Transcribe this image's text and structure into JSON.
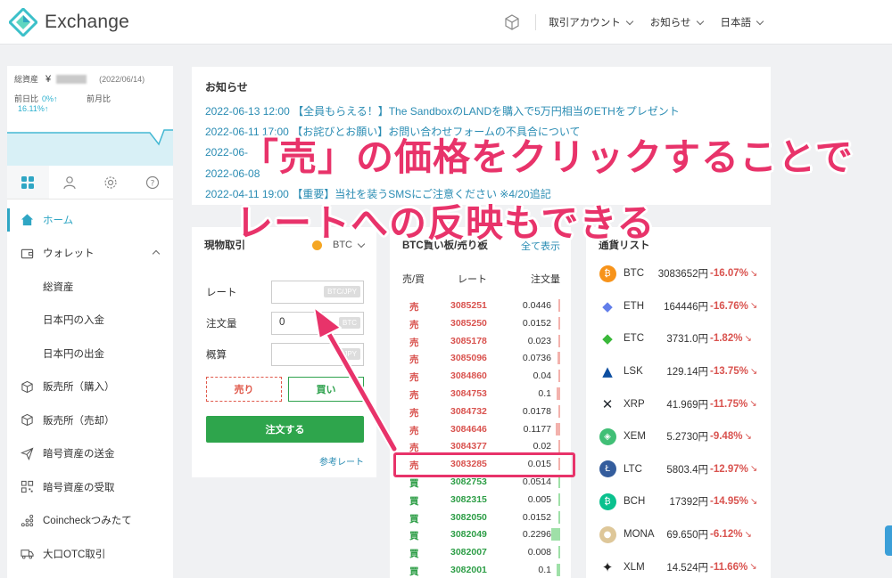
{
  "header": {
    "brand": "Exchange",
    "nav": [
      "取引アカウント",
      "お知らせ",
      "日本語"
    ]
  },
  "sidebar": {
    "assets": {
      "label": "総資産",
      "currency": "¥",
      "date": "(2022/06/14)",
      "day_label": "前日比",
      "day_pct": "0%↑",
      "month_label": "前月比",
      "month_pct": "16.11%↑"
    },
    "tabs": [
      "dashboard-icon",
      "user-icon",
      "gear-icon",
      "help-icon"
    ],
    "menu": [
      {
        "label": "ホーム",
        "icon": "home-icon"
      },
      {
        "label": "ウォレット",
        "icon": "wallet-icon"
      },
      {
        "label": "総資産",
        "icon": ""
      },
      {
        "label": "日本円の入金",
        "icon": ""
      },
      {
        "label": "日本円の出金",
        "icon": ""
      },
      {
        "label": "販売所（購入）",
        "icon": "cube-icon"
      },
      {
        "label": "販売所（売却）",
        "icon": "cube-icon"
      },
      {
        "label": "暗号資産の送金",
        "icon": "send-icon"
      },
      {
        "label": "暗号資産の受取",
        "icon": "qr-icon"
      },
      {
        "label": "Coincheckつみたて",
        "icon": "dots-icon"
      },
      {
        "label": "大口OTC取引",
        "icon": "truck-icon"
      }
    ]
  },
  "news": {
    "title": "お知らせ",
    "items": [
      "2022-06-13 12:00 【全員もらえる！】The SandboxのLANDを購入で5万円相当のETHをプレゼント",
      "2022-06-11 17:00 【お詫びとお願い】お問い合わせフォームの不具合について",
      "2022-06-",
      "2022-06-08",
      "2022-04-11 19:00 【重要】当社を装うSMSにご注意ください ※4/20追記"
    ]
  },
  "trade": {
    "title": "現物取引",
    "coin": "BTC",
    "rate_label": "レート",
    "rate_unit": "BTC/JPY",
    "amount_label": "注文量",
    "amount_value": "0",
    "amount_unit": "BTC",
    "estimate_label": "概算",
    "estimate_unit": "JPY",
    "sell_label": "売り",
    "buy_label": "買い",
    "order_label": "注文する",
    "ref_label": "参考レート"
  },
  "orderbook": {
    "title": "BTC買い板/売り板",
    "show_all": "全て表示",
    "col_side": "売/買",
    "col_rate": "レート",
    "col_qty": "注文量",
    "rows": [
      {
        "side": "売",
        "rate": "3085251",
        "qty": "0.0446",
        "depth": 0.02
      },
      {
        "side": "売",
        "rate": "3085250",
        "qty": "0.0152",
        "depth": 0.01
      },
      {
        "side": "売",
        "rate": "3085178",
        "qty": "0.023",
        "depth": 0.01
      },
      {
        "side": "売",
        "rate": "3085096",
        "qty": "0.0736",
        "depth": 0.03
      },
      {
        "side": "売",
        "rate": "3084860",
        "qty": "0.04",
        "depth": 0.02
      },
      {
        "side": "売",
        "rate": "3084753",
        "qty": "0.1",
        "depth": 0.04
      },
      {
        "side": "売",
        "rate": "3084732",
        "qty": "0.0178",
        "depth": 0.01
      },
      {
        "side": "売",
        "rate": "3084646",
        "qty": "0.1177",
        "depth": 0.05
      },
      {
        "side": "売",
        "rate": "3084377",
        "qty": "0.02",
        "depth": 0.01
      },
      {
        "side": "売",
        "rate": "3083285",
        "qty": "0.015",
        "depth": 0.01
      },
      {
        "side": "買",
        "rate": "3082753",
        "qty": "0.0514",
        "depth": 0.02
      },
      {
        "side": "買",
        "rate": "3082315",
        "qty": "0.005",
        "depth": 0.005
      },
      {
        "side": "買",
        "rate": "3082050",
        "qty": "0.0152",
        "depth": 0.01
      },
      {
        "side": "買",
        "rate": "3082049",
        "qty": "0.2296",
        "depth": 0.1
      },
      {
        "side": "買",
        "rate": "3082007",
        "qty": "0.008",
        "depth": 0.005
      },
      {
        "side": "買",
        "rate": "3082001",
        "qty": "0.1",
        "depth": 0.04
      }
    ]
  },
  "coins": {
    "title": "通貨リスト",
    "items": [
      {
        "sym": "BTC",
        "price": "3083652円",
        "chg": "-16.07%",
        "color": "#f7931a"
      },
      {
        "sym": "ETH",
        "price": "164446円",
        "chg": "-16.76%",
        "color": "#627eea"
      },
      {
        "sym": "ETC",
        "price": "3731.0円",
        "chg": "-1.82%",
        "color": "#3ab83a"
      },
      {
        "sym": "LSK",
        "price": "129.14円",
        "chg": "-13.75%",
        "color": "#0d4ea0"
      },
      {
        "sym": "XRP",
        "price": "41.969円",
        "chg": "-11.75%",
        "color": "#23292f"
      },
      {
        "sym": "XEM",
        "price": "5.2730円",
        "chg": "-9.48%",
        "color": "#41bf76"
      },
      {
        "sym": "LTC",
        "price": "5803.4円",
        "chg": "-12.97%",
        "color": "#345d9d"
      },
      {
        "sym": "BCH",
        "price": "17392円",
        "chg": "-14.95%",
        "color": "#0ac18e"
      },
      {
        "sym": "MONA",
        "price": "69.650円",
        "chg": "-6.12%",
        "color": "#dec799"
      },
      {
        "sym": "XLM",
        "price": "14.524円",
        "chg": "-11.66%",
        "color": "#222"
      }
    ]
  },
  "annotation": {
    "line1": "「売」の価格をクリックすることで",
    "line2": "レートへの反映もできる"
  },
  "colors": {
    "accent": "#2fa6c4",
    "sell": "#d9534f",
    "buy": "#2e9e47",
    "annotation": "#e8336a"
  }
}
